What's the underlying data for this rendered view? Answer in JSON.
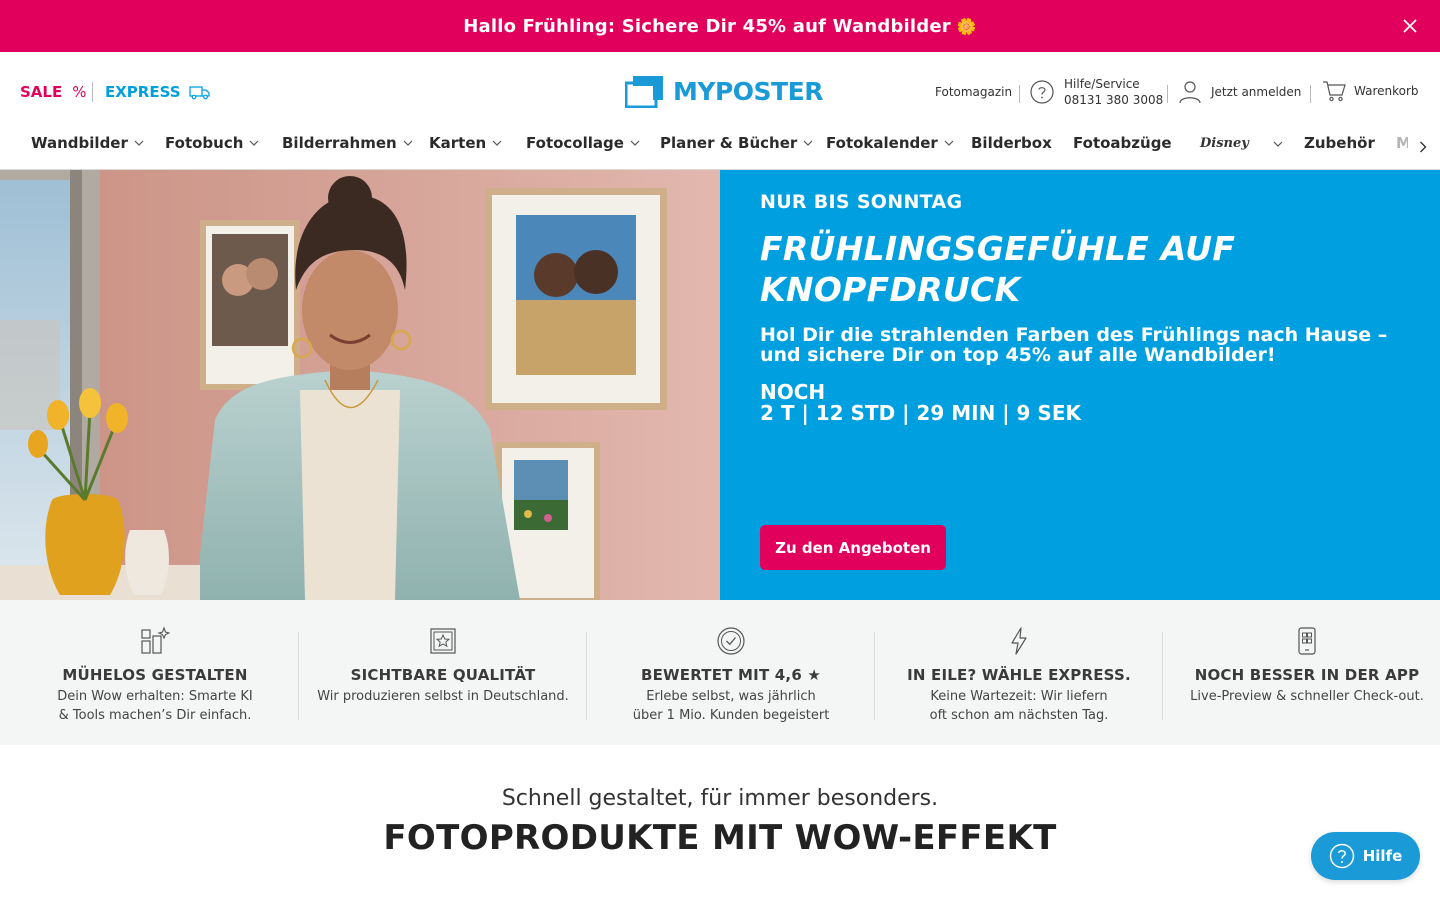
{
  "promo": {
    "text": "Hallo Frühling: Sichere Dir 45% auf Wandbilder",
    "emoji": "🌼"
  },
  "header": {
    "sale_label": "SALE",
    "sale_icon": "%",
    "express_label": "EXPRESS",
    "logo_text": "MYPOSTER",
    "magazin_label": "Fotomagazin",
    "help_label": "Hilfe/Service",
    "help_phone": "08131 380 3008",
    "login_label": "Jetzt anmelden",
    "cart_label": "Warenkorb"
  },
  "nav": {
    "items": [
      {
        "label": "Wandbilder"
      },
      {
        "label": "Fotobuch"
      },
      {
        "label": "Bilderrahmen"
      },
      {
        "label": "Karten"
      },
      {
        "label": "Fotocollage"
      },
      {
        "label": "Planer & Bücher"
      },
      {
        "label": "Fotokalender"
      },
      {
        "label": "Bilderbox"
      },
      {
        "label": "Fotoabzüge"
      },
      {
        "label": "Disney"
      },
      {
        "label": "Zubehör"
      },
      {
        "label": "M"
      }
    ]
  },
  "hero": {
    "eyebrow": "NUR BIS SONNTAG",
    "title_line1": "FRÜHLINGSGEFÜHLE AUF",
    "title_line2": "KNOPFDRUCK",
    "subtitle": "Hol Dir die strahlenden Farben des Frühlings nach Hause – und sichere Dir on top 45% auf alle Wandbilder!",
    "countdown_label": "NOCH",
    "countdown": "2 T | 12 STD | 29 MIN | 9 SEK",
    "cta": "Zu den Angeboten"
  },
  "usps": [
    {
      "icon": "design-tools-icon",
      "title": "MÜHELOS GESTALTEN",
      "line1": "Dein Wow erhalten: Smarte KI",
      "line2": "& Tools machen’s Dir einfach."
    },
    {
      "icon": "quality-star-icon",
      "title": "SICHTBARE QUALITÄT",
      "line1": "Wir produzieren selbst in Deutschland.",
      "line2": ""
    },
    {
      "icon": "check-badge-icon",
      "title": "BEWERTET MIT 4,6 ★",
      "line1": "Erlebe selbst, was jährlich",
      "line2": "über 1 Mio. Kunden begeistert"
    },
    {
      "icon": "lightning-icon",
      "title": "IN EILE? WÄHLE EXPRESS.",
      "line1": "Keine Wartezeit: Wir liefern",
      "line2": "oft schon am nächsten Tag."
    },
    {
      "icon": "phone-app-icon",
      "title": "NOCH BESSER IN DER APP",
      "line1": "Live-Preview & schneller Check-out.",
      "line2": ""
    }
  ],
  "section": {
    "subtitle": "Schnell gestaltet, für immer besonders.",
    "title": "FOTOPRODUKTE MIT WOW-EFFEKT"
  },
  "help_fab": {
    "label": "Hilfe"
  },
  "colors": {
    "brand_pink": "#e2005d",
    "brand_blue": "#00a0e0",
    "logo_blue": "#1a9ad6"
  }
}
